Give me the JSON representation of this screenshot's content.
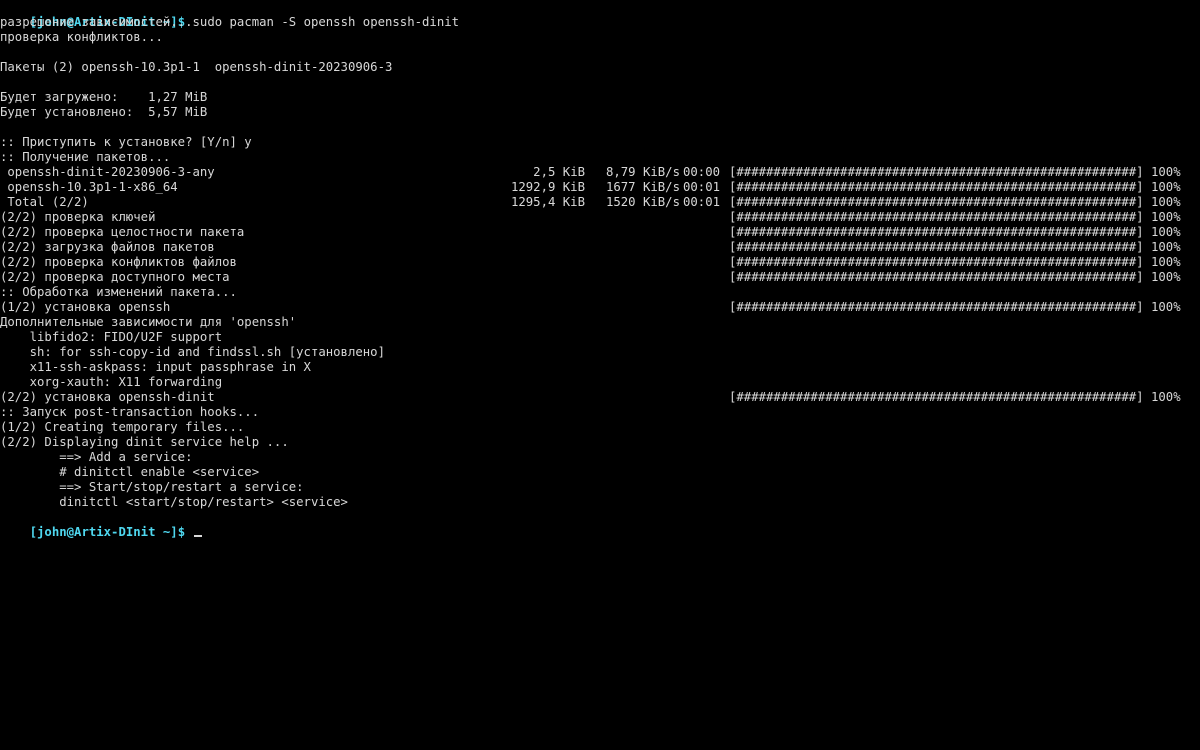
{
  "colors": {
    "background": "#000000",
    "text": "#d8d8d8",
    "prompt": "#4fd8f0"
  },
  "prompt": "[john@Artix-DInit ~]$",
  "command": "sudo pacman -S openssh openssh-dinit",
  "lines": {
    "l1": "разрешение зависимостей...",
    "l2": "проверка конфликтов...",
    "l4": "Пакеты (2) openssh-10.3p1-1  openssh-dinit-20230906-3",
    "l6": "Будет загружено:    1,27 MiB",
    "l7": "Будет установлено:  5,57 MiB",
    "l9": ":: Приступить к установке? [Y/n] y",
    "l10": ":: Получение пакетов...",
    "l14": "(2/2) проверка ключей",
    "l15": "(2/2) проверка целостности пакета",
    "l16": "(2/2) загрузка файлов пакетов",
    "l17": "(2/2) проверка конфликтов файлов",
    "l18": "(2/2) проверка доступного места",
    "l19": ":: Обработка изменений пакета...",
    "l20": "(1/2) установка openssh",
    "l21": "Дополнительные зависимости для 'openssh'",
    "l22": "    libfido2: FIDO/U2F support",
    "l23": "    sh: for ssh-copy-id and findssl.sh [установлено]",
    "l24": "    x11-ssh-askpass: input passphrase in X",
    "l25": "    xorg-xauth: X11 forwarding",
    "l26": "(2/2) установка openssh-dinit",
    "l27": ":: Запуск post-transaction hooks...",
    "l28": "(1/2) Creating temporary files...",
    "l29": "(2/2) Displaying dinit service help ...",
    "l30": "        ==> Add a service:",
    "l31": "        # dinitctl enable <service>",
    "l32": "        ==> Start/stop/restart a service:",
    "l33": "        dinitctl <start/stop/restart> <service>"
  },
  "downloads": [
    {
      "name": " openssh-dinit-20230906-3-any",
      "size": "2,5 KiB",
      "rate": "8,79 KiB/s",
      "time": "00:00"
    },
    {
      "name": " openssh-10.3p1-1-x86_64",
      "size": "1292,9 KiB",
      "rate": "1677 KiB/s",
      "time": "00:01"
    },
    {
      "name": " Total (2/2)",
      "size": "1295,4 KiB",
      "rate": "1520 KiB/s",
      "time": "00:01"
    }
  ],
  "progress_bar": "[######################################################] 100%"
}
